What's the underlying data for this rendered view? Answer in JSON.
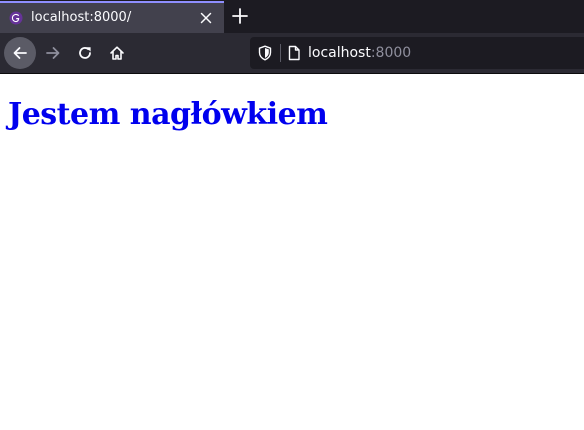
{
  "tab": {
    "title": "localhost:8000/",
    "favicon": "gatsby-icon"
  },
  "toolbar": {
    "url_host": "localhost",
    "url_port": ":8000"
  },
  "page": {
    "heading": "Jestem nagłówkiem",
    "heading_color": "#0000ee"
  },
  "colors": {
    "tabstrip_bg": "#1c1b22",
    "toolbar_bg": "#2b2a33",
    "tab_accent": "#8f8fff"
  }
}
